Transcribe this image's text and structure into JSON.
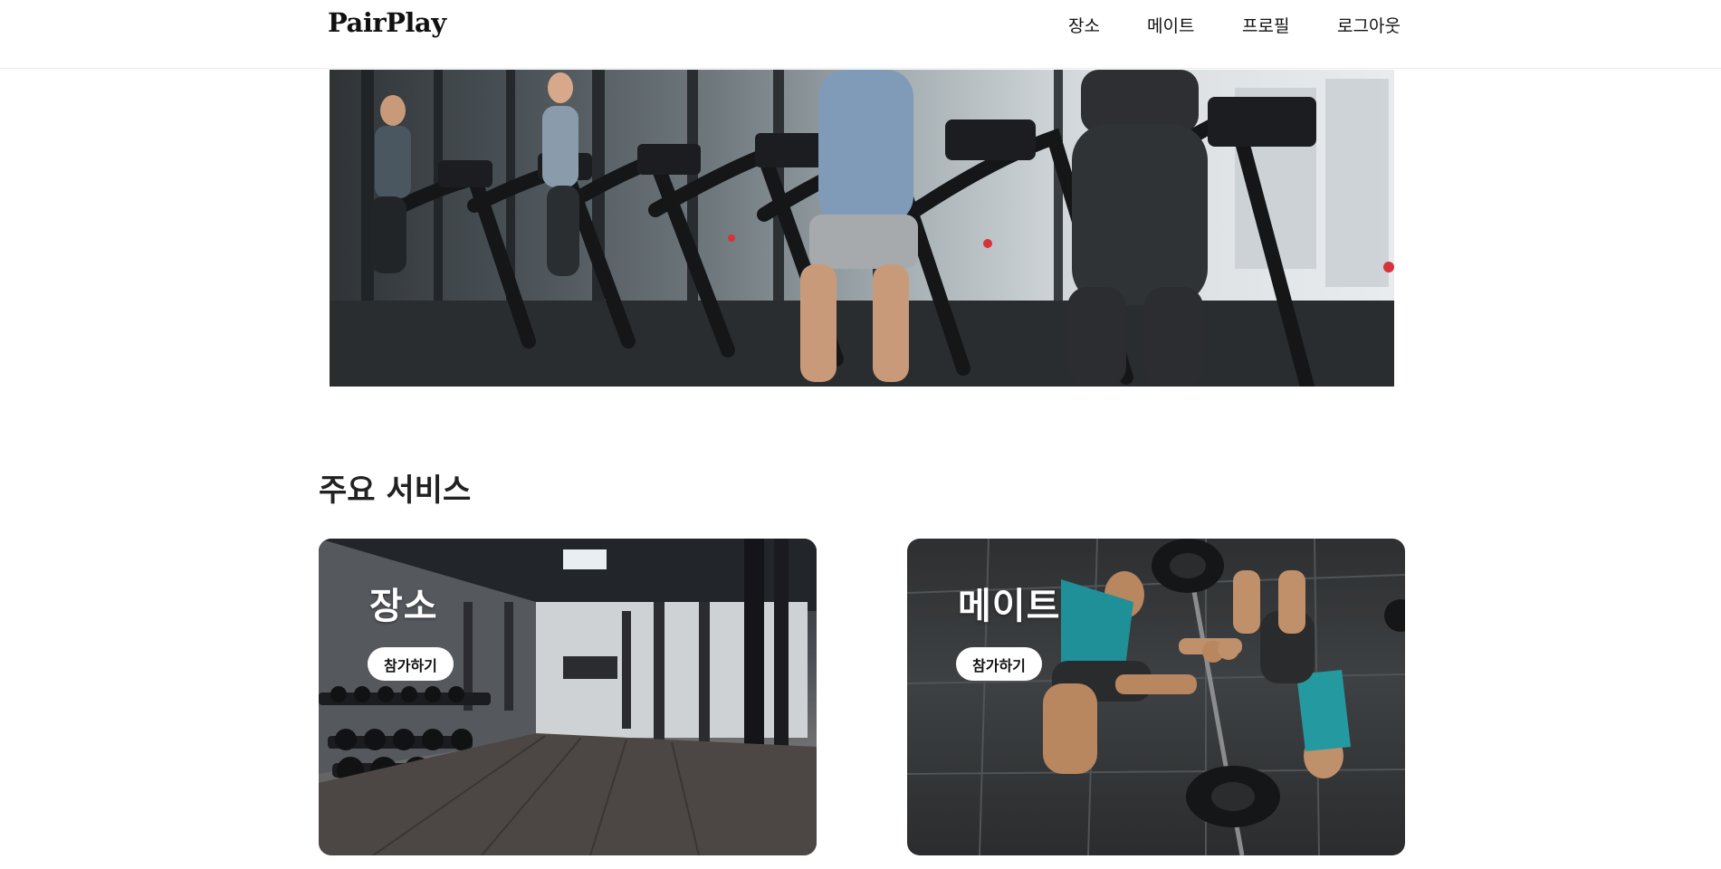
{
  "header": {
    "brand": "PairPlay",
    "nav": [
      {
        "label": "장소"
      },
      {
        "label": "메이트"
      },
      {
        "label": "프로필"
      },
      {
        "label": "로그아웃"
      }
    ]
  },
  "hero": {
    "image": "treadmill-gym-photo"
  },
  "services": {
    "title": "주요 서비스",
    "cards": [
      {
        "title": "장소",
        "button": "참가하기",
        "image": "gym-interior-photo"
      },
      {
        "title": "메이트",
        "button": "참가하기",
        "image": "workout-partners-photo"
      }
    ]
  }
}
